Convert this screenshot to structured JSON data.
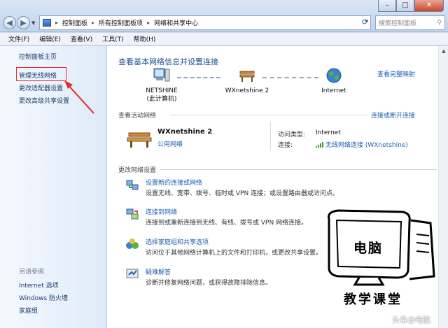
{
  "window": {
    "controls": {
      "minimize": "–",
      "maximize": "□",
      "close": "✕"
    }
  },
  "address": {
    "crumbs": [
      "控制面板",
      "所有控制面板项",
      "网络和共享中心"
    ],
    "search_placeholder": "搜索控制面板"
  },
  "menu": [
    "文件(F)",
    "编辑(E)",
    "查看(V)",
    "工具(T)",
    "帮助(H)"
  ],
  "sidebar": {
    "home": "控制面板主页",
    "links": [
      "管理无线网络",
      "更改适配器设置",
      "更改高级共享设置"
    ],
    "see_also_heading": "另请参阅",
    "see_also": [
      "Internet 选项",
      "Windows 防火墙",
      "家庭组"
    ]
  },
  "main": {
    "title": "查看基本网络信息并设置连接",
    "view_full_map": "查看完整映射",
    "map_nodes": [
      {
        "label": "NETSHINE",
        "sublabel": "(此计算机)"
      },
      {
        "label": "WXnetshine  2",
        "sublabel": ""
      },
      {
        "label": "Internet",
        "sublabel": ""
      }
    ],
    "active_section": "查看活动网络",
    "connect_disconnect": "连接或断开连接",
    "active_network": {
      "name": "WXnetshine  2",
      "type": "公用网络",
      "access_key": "访问类型:",
      "access_val": "Internet",
      "conn_key": "连接:",
      "conn_val": "无线网络连接 (WXnetshine)"
    },
    "change_section": "更改网络设置",
    "tasks": [
      {
        "title": "设置新的连接或网络",
        "desc": "设置无线、宽带、拨号、临时或 VPN 连接；或设置路由器或访问点。"
      },
      {
        "title": "连接到网络",
        "desc": "连接到或重新连接到无线、有线、拨号或 VPN 网络连接。"
      },
      {
        "title": "选择家庭组和共享选项",
        "desc": "访问位于其他网络计算机上的文件和打印机，或更改共享设置。"
      },
      {
        "title": "疑难解答",
        "desc": "诊断并修复网络问题，或获得故障排除信息。"
      }
    ]
  },
  "logo": {
    "line1": "电脑",
    "line2": "教学课堂"
  },
  "watermark": "头条@电脑",
  "colors": {
    "link": "#1a5fb4",
    "title": "#1e4f93",
    "highlight": "#e32d2d"
  }
}
